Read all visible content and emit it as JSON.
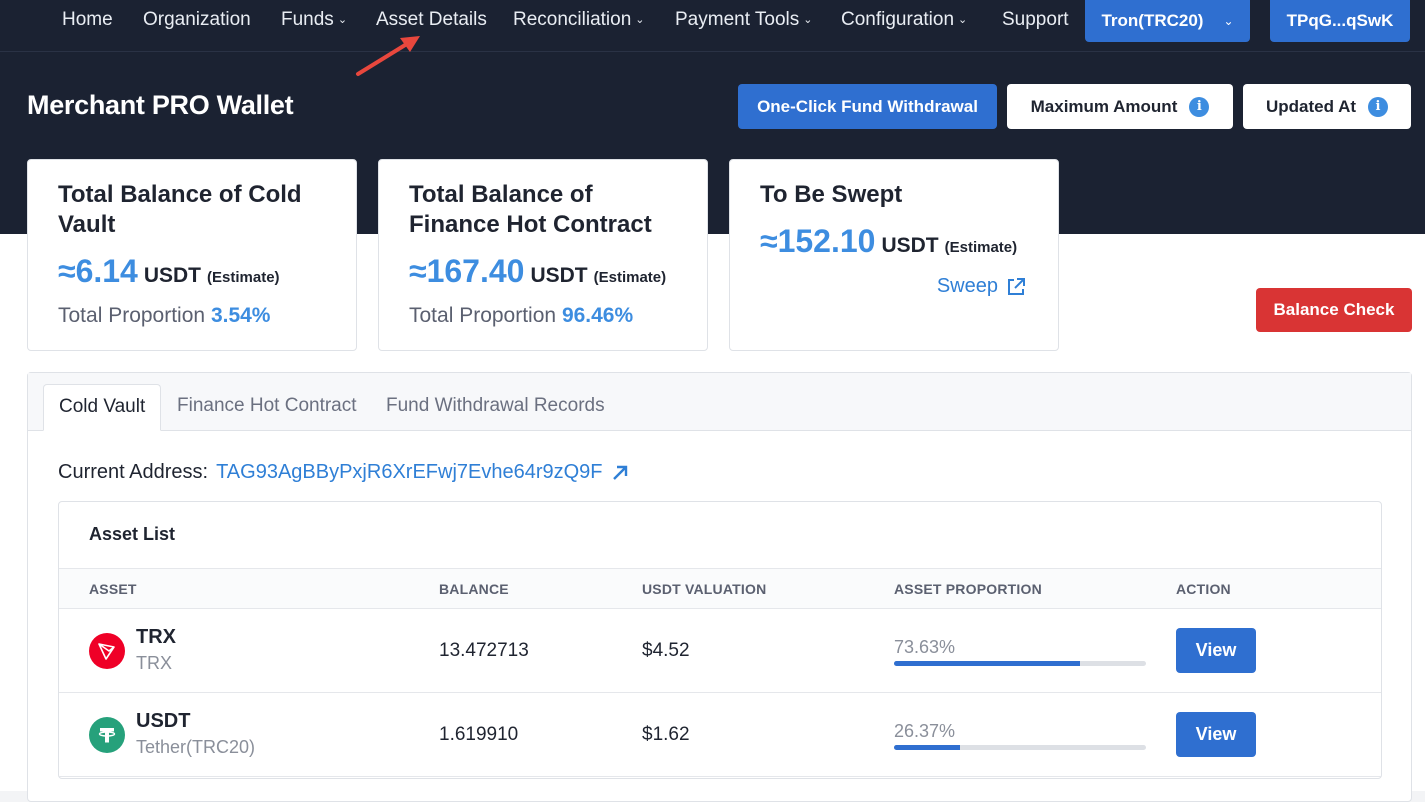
{
  "nav": {
    "items": [
      {
        "label": "Home",
        "caret": false
      },
      {
        "label": "Organization",
        "caret": false
      },
      {
        "label": "Funds",
        "caret": true
      },
      {
        "label": "Asset Details",
        "caret": false
      },
      {
        "label": "Reconciliation",
        "caret": true
      },
      {
        "label": "Payment Tools",
        "caret": true
      },
      {
        "label": "Configuration",
        "caret": true
      },
      {
        "label": "Support",
        "caret": false
      }
    ],
    "network_label": "Tron(TRC20)",
    "account_label": "TPqG...qSwK"
  },
  "header": {
    "title": "Merchant PRO Wallet",
    "withdraw_label": "One-Click Fund Withdrawal",
    "max_amount_label": "Maximum Amount",
    "updated_at_label": "Updated At",
    "info_glyph": "i"
  },
  "cards": [
    {
      "title": "Total Balance of Cold Vault",
      "amount": "≈6.14",
      "unit": "USDT",
      "estimate": "(Estimate)",
      "proportion_label": "Total Proportion",
      "proportion": "3.54%"
    },
    {
      "title": "Total Balance of Finance Hot Contract",
      "amount": "≈167.40",
      "unit": "USDT",
      "estimate": "(Estimate)",
      "proportion_label": "Total Proportion",
      "proportion": "96.46%"
    },
    {
      "title": "To Be Swept",
      "amount": "≈152.10",
      "unit": "USDT",
      "estimate": "(Estimate)",
      "link_label": "Sweep"
    }
  ],
  "balance_check_label": "Balance Check",
  "tabs": [
    "Cold Vault",
    "Finance Hot Contract",
    "Fund Withdrawal Records"
  ],
  "active_tab": "Cold Vault",
  "current_address": {
    "label": "Current Address:",
    "value": "TAG93AgBByPxjR6XrEFwj7Evhe64r9zQ9F"
  },
  "asset_list": {
    "title": "Asset List",
    "columns": [
      "ASSET",
      "BALANCE",
      "USDT VALUATION",
      "ASSET PROPORTION",
      "ACTION"
    ],
    "rows": [
      {
        "symbol": "TRX",
        "name": "TRX",
        "balance": "13.472713",
        "valuation": "$4.52",
        "proportion": "73.63%",
        "proportion_value": 73.63,
        "action": "View",
        "icon": "tron-icon",
        "icon_color": "#ef0027"
      },
      {
        "symbol": "USDT",
        "name": "Tether(TRC20)",
        "balance": "1.619910",
        "valuation": "$1.62",
        "proportion": "26.37%",
        "proportion_value": 26.37,
        "action": "View",
        "icon": "tether-icon",
        "icon_color": "#26a17b"
      }
    ]
  },
  "colors": {
    "nav_bg": "#1b2232",
    "primary": "#2f6fd0",
    "accent_text": "#3d8de0",
    "danger": "#d93434",
    "annotation_arrow": "#e8473d"
  }
}
